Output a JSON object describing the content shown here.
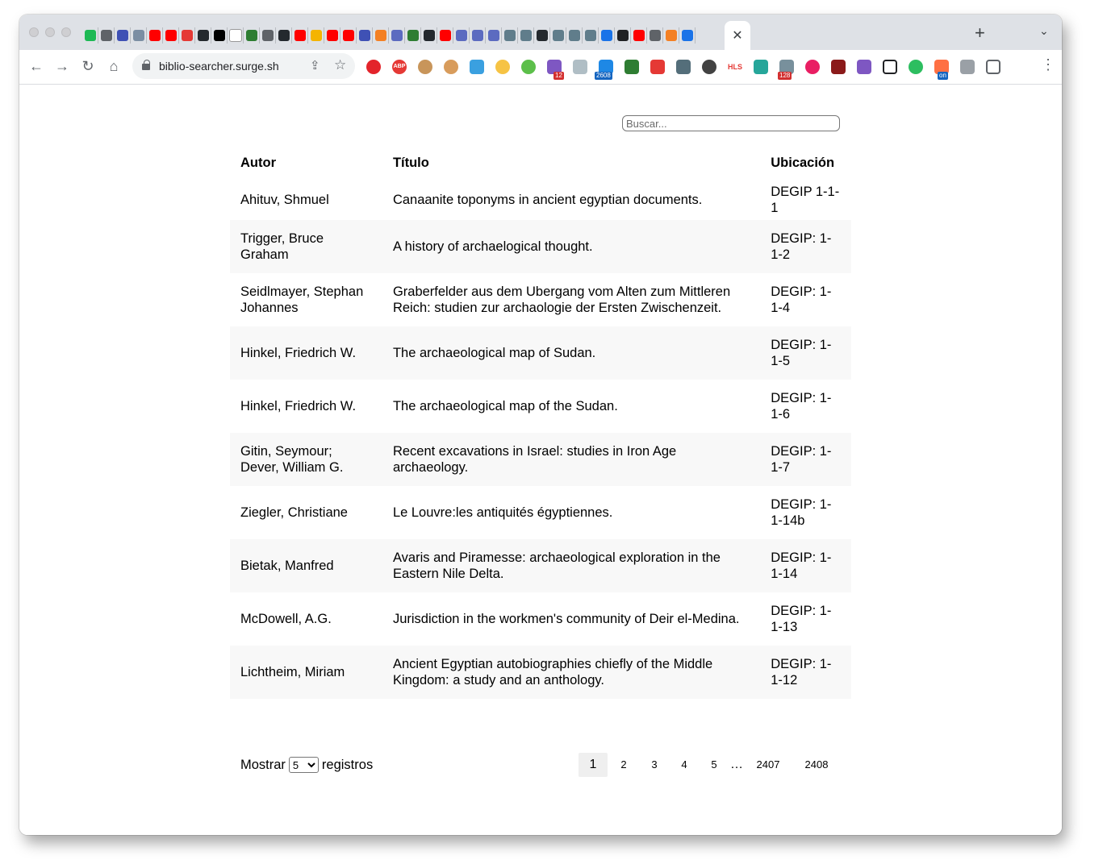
{
  "browser": {
    "url": "biblio-searcher.surge.sh",
    "tab_close_glyph": "✕",
    "new_tab_glyph": "+",
    "tab_menu_glyph": "⌄",
    "nav": {
      "back": "←",
      "forward": "→",
      "reload": "↻",
      "home": "⌂"
    },
    "omnibox_icons": {
      "share": "⇪",
      "star": "☆"
    },
    "menu_glyph": "⋮",
    "extension_badges": [
      "12",
      "2608",
      "128",
      "on"
    ],
    "extension_text": [
      "ABP",
      "HLS"
    ]
  },
  "search": {
    "placeholder": "Buscar..."
  },
  "table": {
    "headers": {
      "autor": "Autor",
      "titulo": "Título",
      "ubicacion": "Ubicación"
    },
    "rows": [
      {
        "autor": "Ahituv, Shmuel",
        "titulo": "Canaanite toponyms in ancient egyptian documents.",
        "ubicacion": "DEGIP 1-1-1"
      },
      {
        "autor": "Trigger, Bruce Graham",
        "titulo": "A history of archaelogical thought.",
        "ubicacion": "DEGIP: 1-1-2"
      },
      {
        "autor": "Seidlmayer, Stephan Johannes",
        "titulo": "Graberfelder aus dem Ubergang vom Alten zum Mittleren Reich: studien zur archaologie der Ersten Zwischenzeit.",
        "ubicacion": "DEGIP: 1-1-4"
      },
      {
        "autor": "Hinkel, Friedrich W.",
        "titulo": "The archaeological map of Sudan.",
        "ubicacion": "DEGIP: 1-1-5"
      },
      {
        "autor": "Hinkel, Friedrich W.",
        "titulo": "The archaeological map of the Sudan.",
        "ubicacion": "DEGIP: 1-1-6"
      },
      {
        "autor": "Gitin, Seymour; Dever, William G.",
        "titulo": "Recent excavations in Israel: studies in Iron Age archaeology.",
        "ubicacion": "DEGIP: 1-1-7"
      },
      {
        "autor": "Ziegler, Christiane",
        "titulo": "Le Louvre:les antiquités égyptiennes.",
        "ubicacion": "DEGIP: 1-1-14b"
      },
      {
        "autor": "Bietak, Manfred",
        "titulo": "Avaris and Piramesse: archaeological exploration in the Eastern Nile Delta.",
        "ubicacion": "DEGIP: 1-1-14"
      },
      {
        "autor": "McDowell, A.G.",
        "titulo": "Jurisdiction in the workmen's community of Deir el-Medina.",
        "ubicacion": "DEGIP: 1-1-13"
      },
      {
        "autor": "Lichtheim, Miriam",
        "titulo": "Ancient Egyptian autobiographies chiefly of the Middle Kingdom: a study and an anthology.",
        "ubicacion": "DEGIP: 1-1-12"
      }
    ]
  },
  "footer": {
    "show_label": "Mostrar",
    "records_label": "registros",
    "page_size": "5",
    "pages": [
      "1",
      "2",
      "3",
      "4",
      "5",
      "…",
      "2407",
      "2408"
    ],
    "active_page": "1"
  }
}
